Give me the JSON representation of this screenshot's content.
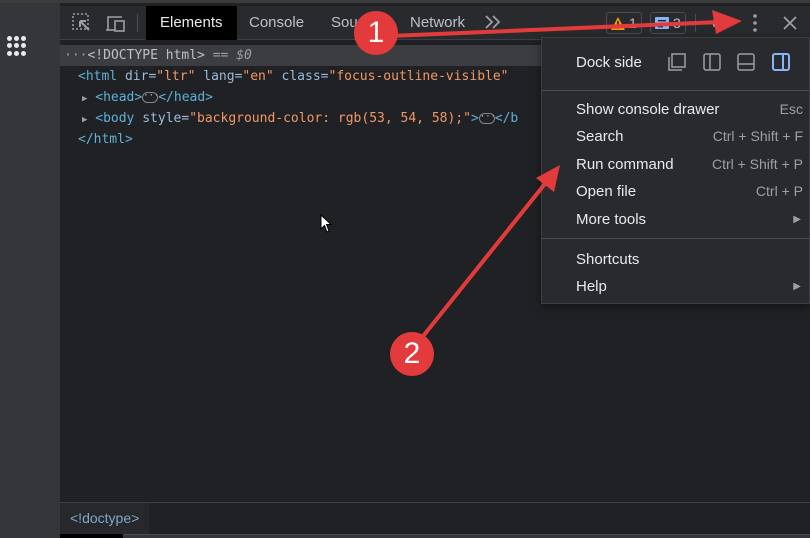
{
  "toolbar": {
    "tabs": [
      {
        "label": "Elements",
        "active": true
      },
      {
        "label": "Console",
        "active": false
      },
      {
        "label": "Sources",
        "active": false
      },
      {
        "label": "Network",
        "active": false
      }
    ],
    "more_tabs_glyph": ">>",
    "warnings_count": "1",
    "messages_count": "3",
    "icons": [
      "inspect-element-icon",
      "device-toolbar-icon",
      "settings-icon",
      "kebab-menu-icon",
      "close-icon"
    ]
  },
  "dom_tree": {
    "doctype": {
      "text": "<!DOCTYPE html>",
      "suffix": " == ",
      "ref": "$0"
    },
    "html_open": {
      "tag": "<html",
      "attrs": [
        {
          "name": "dir",
          "value": "\"ltr\""
        },
        {
          "name": "lang",
          "value": "\"en\""
        },
        {
          "name": "class",
          "value": "\"focus-outline-visible\""
        }
      ]
    },
    "head": {
      "open": "<head>",
      "close": "</head>"
    },
    "body": {
      "open": "<body",
      "attr_name": "style",
      "attr_value": "\"background-color: rgb(53, 54, 58);\"",
      "gt": ">",
      "close": "</b"
    },
    "html_close": "</html>"
  },
  "breadcrumb": "<!doctype>",
  "menu": {
    "dock_side_label": "Dock side",
    "dock_options": [
      "undock-icon",
      "dock-left-icon",
      "dock-bottom-icon",
      "dock-right-icon"
    ],
    "dock_selected": "dock-right-icon",
    "items": [
      {
        "label": "Show console drawer",
        "shortcut": "Esc"
      },
      {
        "label": "Search",
        "shortcut": "Ctrl + Shift + F"
      },
      {
        "label": "Run command",
        "shortcut": "Ctrl + Shift + P"
      },
      {
        "label": "Open file",
        "shortcut": "Ctrl + P"
      },
      {
        "label": "More tools",
        "submenu": true
      }
    ],
    "items2": [
      {
        "label": "Shortcuts"
      },
      {
        "label": "Help",
        "submenu": true
      }
    ]
  },
  "annotations": {
    "step1": "1",
    "step2": "2",
    "color": "#e33b3b"
  },
  "colors": {
    "accent": "#8ab4f8",
    "warning": "#f29900",
    "tag": "#5db0d7",
    "attr_value": "#f29766"
  }
}
